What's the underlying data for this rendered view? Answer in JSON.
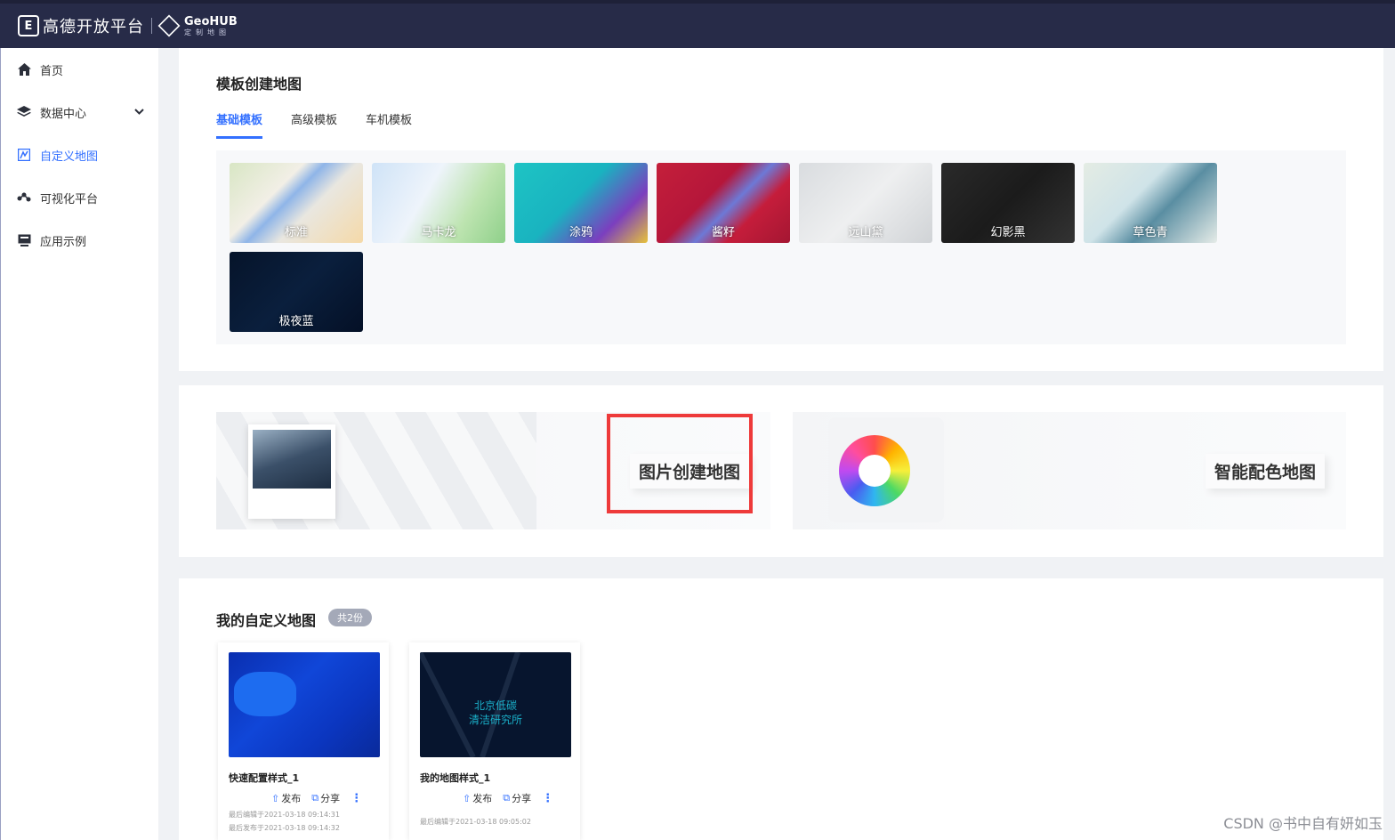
{
  "header": {
    "logo_char": "E",
    "brand": "高德开放平台",
    "geo_title": "GeoHUB",
    "geo_sub": "定制地图"
  },
  "sidebar": {
    "items": [
      {
        "label": "首页",
        "icon": "home-icon"
      },
      {
        "label": "数据中心",
        "icon": "layers-icon"
      },
      {
        "label": "自定义地图",
        "icon": "custom-map-icon"
      },
      {
        "label": "可视化平台",
        "icon": "visualization-icon"
      },
      {
        "label": "应用示例",
        "icon": "app-example-icon"
      }
    ],
    "active_index": 2
  },
  "templates": {
    "title": "模板创建地图",
    "tabs": [
      "基础模板",
      "高级模板",
      "车机模板"
    ],
    "active_tab": 0,
    "items": [
      "标准",
      "马卡龙",
      "涂鸦",
      "酱籽",
      "远山黛",
      "幻影黑",
      "草色青",
      "极夜蓝"
    ]
  },
  "features": {
    "image_create": "图片创建地图",
    "smart_color": "智能配色地图"
  },
  "my_maps": {
    "title": "我的自定义地图",
    "count": "共2份",
    "publish": "发布",
    "share": "分享",
    "cards": [
      {
        "name": "快速配置样式_1",
        "edited": "最后编辑于2021-03-18 09:14:31",
        "published": "最后发布于2021-03-18 09:14:32"
      },
      {
        "name": "我的地图样式_1",
        "edited": "最后编辑于2021-03-18 09:05:02",
        "thumb_text_1": "北京低碳",
        "thumb_text_2": "清洁研究所"
      }
    ]
  },
  "watermark": "CSDN @书中自有妍如玉",
  "colors": {
    "accent": "#3370ff",
    "header": "#272b48",
    "highlight": "#ee3a3a"
  }
}
